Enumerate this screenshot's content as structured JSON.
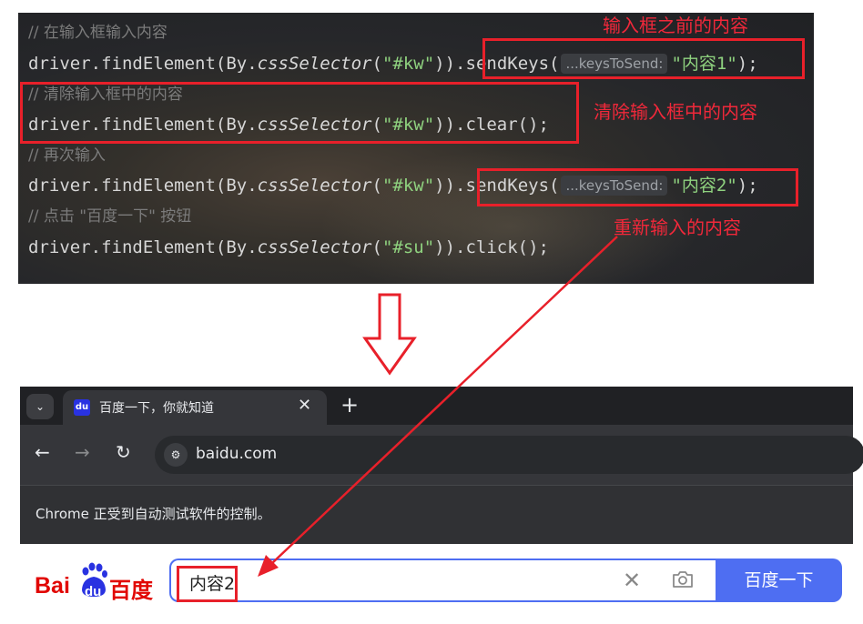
{
  "code": {
    "comment1": "// 在输入框输入内容",
    "line1_prefix": "driver.findElement(By.",
    "line1_method": "cssSelector",
    "line1_arg": "\"#kw\"",
    "line1_mid": ")).",
    "line1_call": "sendKeys(",
    "line1_hint": "...keysToSend:",
    "line1_value": "\"内容1\"",
    "line1_end": ");",
    "comment2": "// 清除输入框中的内容",
    "line2_prefix": "driver.findElement(By.",
    "line2_method": "cssSelector",
    "line2_arg": "\"#kw\"",
    "line2_end": ")).clear();",
    "comment3": "// 再次输入",
    "line3_prefix": "driver.findElement(By.",
    "line3_method": "cssSelector",
    "line3_arg": "\"#kw\"",
    "line3_mid": ")).",
    "line3_call": "sendKeys(",
    "line3_hint": "...keysToSend:",
    "line3_value": "\"内容2\"",
    "line3_end": ");",
    "comment4": "// 点击 \"百度一下\" 按钮",
    "line4_prefix": "driver.findElement(By.",
    "line4_method": "cssSelector",
    "line4_arg": "\"#su\"",
    "line4_end": ")).click();"
  },
  "annotations": {
    "before_content": "输入框之前的内容",
    "clear_content": "清除输入框中的内容",
    "new_content": "重新输入的内容",
    "color": "#e8202a"
  },
  "browser": {
    "tab_title": "百度一下，你就知道",
    "tab_close": "✕",
    "new_tab": "+",
    "tab_search_icon": "⌄",
    "favicon_text": "du",
    "back": "←",
    "forward": "→",
    "reload": "↻",
    "site_info_icon": "⚙",
    "url": "baidu.com",
    "infobar": "Chrome 正受到自动测试软件的控制。"
  },
  "baidu": {
    "logo_latin": "Bai",
    "logo_cn": "百度",
    "logo_paw_text": "du",
    "search_value": "内容2",
    "clear_icon": "✕",
    "search_button": "百度一下",
    "brand_color": "#4e6ef2",
    "logo_color": "#e10602"
  }
}
